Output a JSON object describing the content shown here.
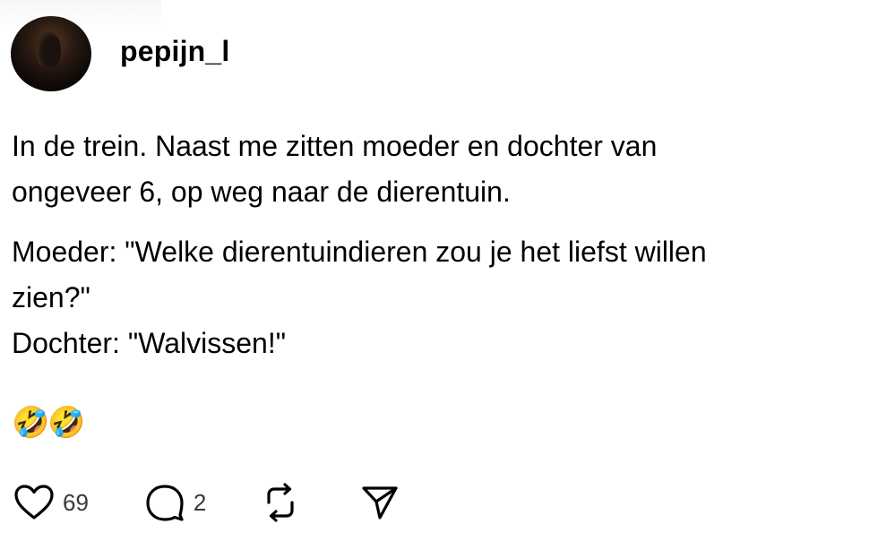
{
  "post": {
    "username": "pepijn_l",
    "paragraphs": [
      [
        "In de trein. Naast me zitten moeder en dochter van",
        "ongeveer 6, op weg naar de dierentuin."
      ],
      [
        "Moeder: \"Welke dierentuindieren zou je het liefst willen",
        "zien?\"",
        "Dochter: \"Walvissen!\""
      ]
    ],
    "emoji": "🤣🤣"
  },
  "actions": {
    "like_icon": "heart-icon",
    "like_count": "69",
    "reply_icon": "comment-icon",
    "reply_count": "2",
    "repost_icon": "repost-icon",
    "share_icon": "send-icon"
  }
}
